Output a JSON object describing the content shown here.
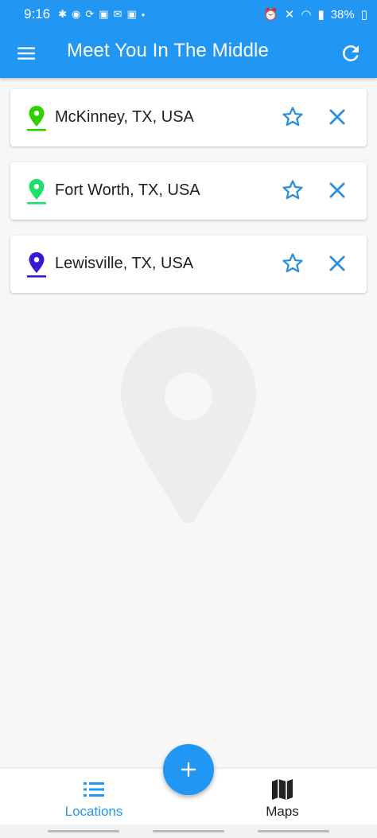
{
  "status_bar": {
    "time": "9:16",
    "battery": "38%",
    "notification_icons": [
      "slack-icon",
      "discord-icon",
      "sync-icon",
      "linkedin-icon",
      "gmail-icon",
      "linkedin-icon",
      "dot-icon"
    ],
    "system_icons": [
      "alarm-icon",
      "mute-icon",
      "wifi-icon",
      "signal-icon",
      "battery-icon"
    ]
  },
  "app_bar": {
    "title": "Meet You In The Middle",
    "menu_icon": "menu-icon",
    "refresh_icon": "refresh-icon",
    "color": "#2196f3"
  },
  "locations": [
    {
      "name": "McKinney, TX, USA",
      "pin_color": "#2ed000"
    },
    {
      "name": "Fort Worth, TX, USA",
      "pin_color": "#1de06a"
    },
    {
      "name": "Lewisville, TX, USA",
      "pin_color": "#3a16d6"
    }
  ],
  "actions": {
    "favorite_icon": "star-outline-icon",
    "remove_icon": "close-icon"
  },
  "fab": {
    "label": "+"
  },
  "bottom_nav": {
    "items": [
      {
        "label": "Locations",
        "icon": "list-icon",
        "active": true
      },
      {
        "label": "Maps",
        "icon": "map-icon",
        "active": false
      }
    ]
  }
}
